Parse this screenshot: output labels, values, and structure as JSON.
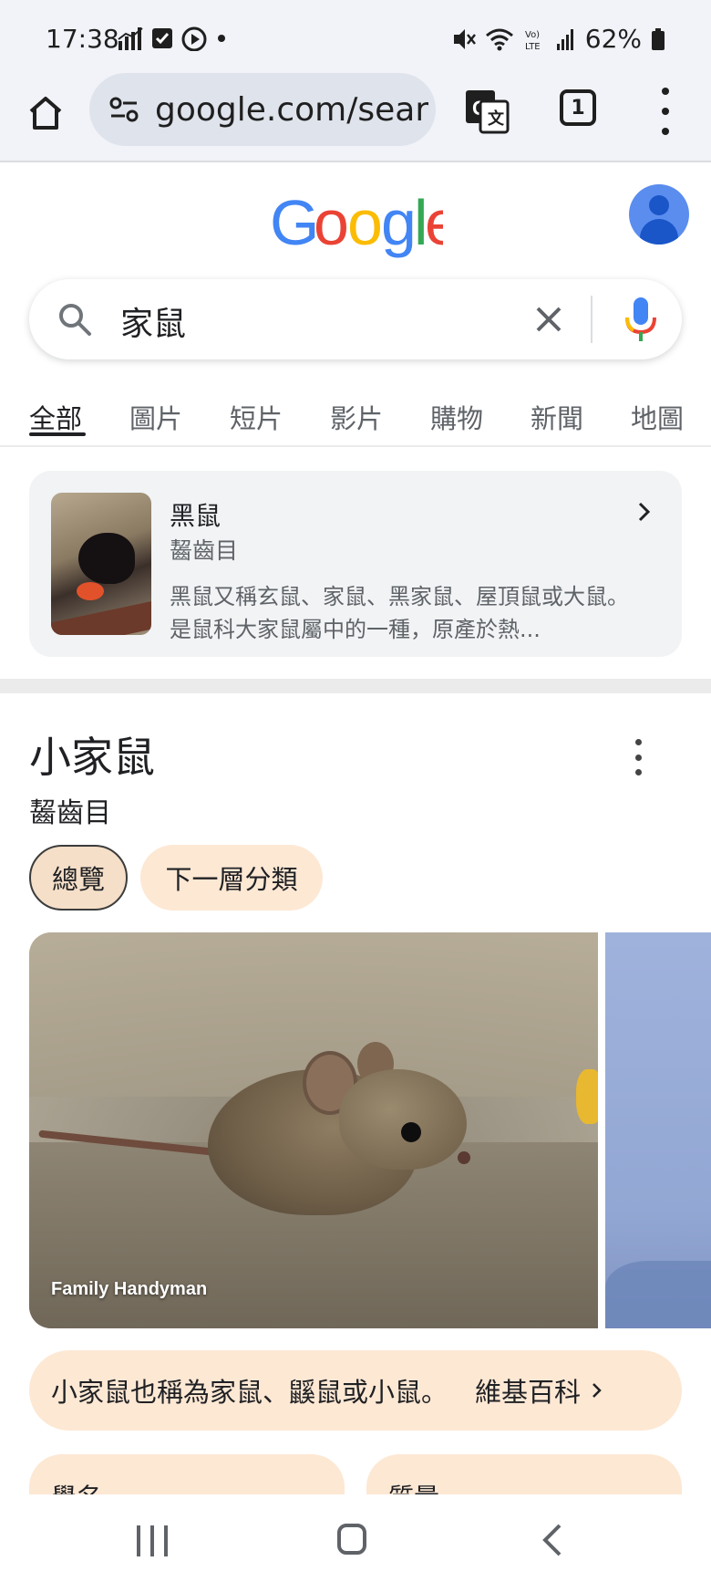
{
  "status_bar": {
    "time": "17:38",
    "battery": "62%",
    "left_icons": [
      "signal-stats-icon",
      "checkbox-icon",
      "youtube-icon",
      "dot-icon"
    ],
    "right_icons": [
      "mute-icon",
      "wifi-icon",
      "volte-icon",
      "signal-icon",
      "battery-icon"
    ]
  },
  "browser": {
    "url": "google.com/search",
    "tab_count": "1"
  },
  "search": {
    "query": "家鼠"
  },
  "tabs": [
    "全部",
    "圖片",
    "短片",
    "影片",
    "購物",
    "新聞",
    "地圖"
  ],
  "related_entity": {
    "title": "黑鼠",
    "subtitle": "齧齒目",
    "description": "黑鼠又稱玄鼠、家鼠、黑家鼠、屋頂鼠或大鼠。是鼠科大家鼠屬中的一種，原產於熱..."
  },
  "knowledge_panel": {
    "title": "小家鼠",
    "subtitle": "齧齒目",
    "chips": [
      "總覽",
      "下一層分類"
    ],
    "photo_credit": "Family Handyman",
    "summary": "小家鼠也稱為家鼠、鼷鼠或小鼠。",
    "summary_source": "維基百科",
    "fact_labels": [
      "學名",
      "質量"
    ]
  },
  "colors": {
    "chip_bg": "#fde8d4",
    "chip_selected_bg": "#f5dfc8",
    "google_blue": "#4285F4",
    "google_red": "#EA4335",
    "google_yellow": "#FBBC05",
    "google_green": "#34A853"
  }
}
